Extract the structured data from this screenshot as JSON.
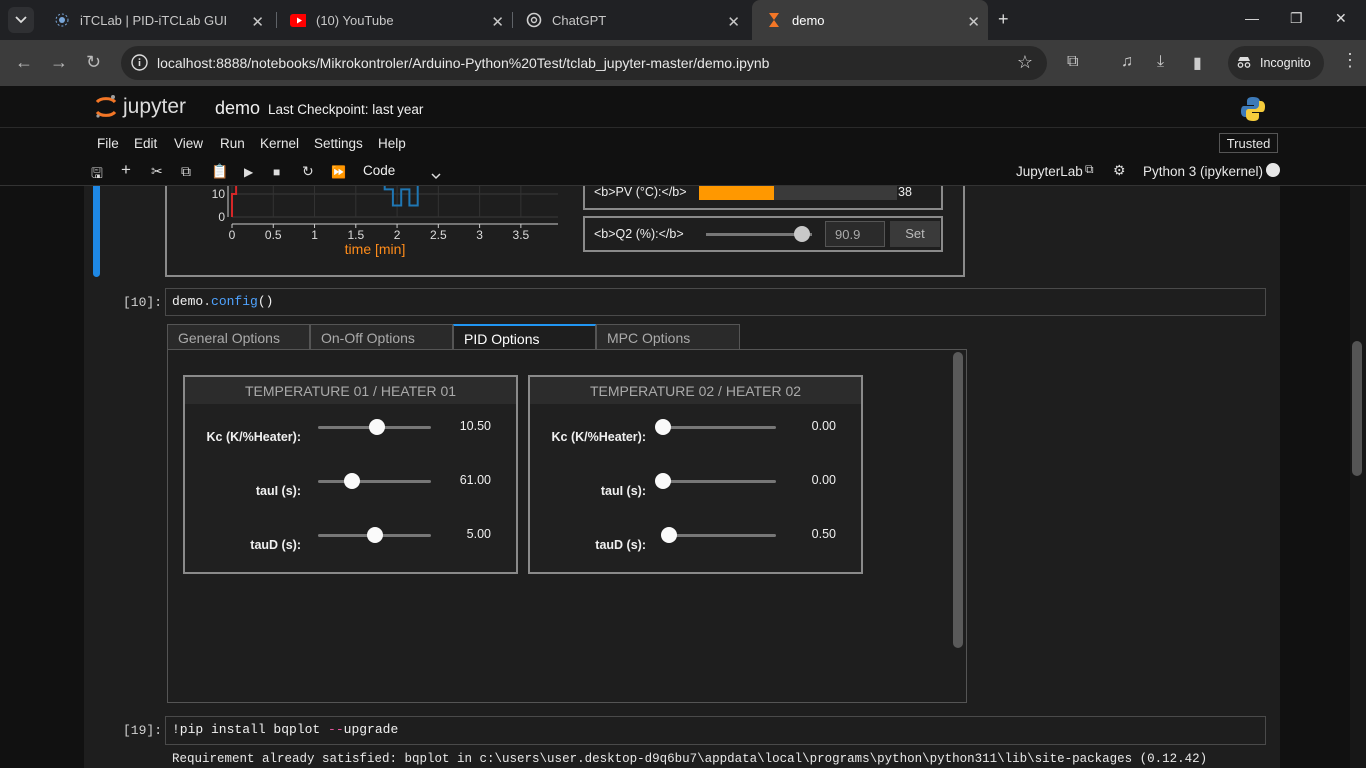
{
  "browser": {
    "tabs": [
      {
        "title": "iTCLab | PID-iTCLab GUI",
        "icon": "itclab-icon"
      },
      {
        "title": "(10) YouTube",
        "icon": "youtube-icon"
      },
      {
        "title": "ChatGPT",
        "icon": "chatgpt-icon"
      },
      {
        "title": "demo",
        "icon": "hourglass-icon"
      }
    ],
    "url": "localhost:8888/notebooks/Mikrokontroler/Arduino-Python%20Test/tclab_jupyter-master/demo.ipynb",
    "incognito_label": "Incognito",
    "colors": {
      "accent": "#f37626",
      "youtube": "#ff0000"
    }
  },
  "jupyter": {
    "logo_text": "jupyter",
    "notebook_name": "demo",
    "checkpoint": "Last Checkpoint: last year",
    "trusted": "Trusted",
    "menus": [
      "File",
      "Edit",
      "View",
      "Run",
      "Kernel",
      "Settings",
      "Help"
    ],
    "cell_type": "Code",
    "jupyterlab_label": "JupyterLab",
    "kernel": "Python 3 (ipykernel)"
  },
  "plot": {
    "chart_data": {
      "type": "line",
      "xlabel": "time [min]",
      "x_ticks": [
        "0",
        "0.5",
        "1",
        "1.5",
        "2",
        "2.5",
        "3",
        "3.5"
      ],
      "y_ticks": [
        "10",
        "0"
      ],
      "series": [
        {
          "color": "#d62728",
          "points": [
            [
              0.0,
              0
            ],
            [
              0.0,
              10
            ],
            [
              0.05,
              10
            ],
            [
              0.05,
              20
            ]
          ]
        },
        {
          "color": "#1f77b4",
          "points": [
            [
              1.85,
              20
            ],
            [
              1.85,
              12
            ],
            [
              1.95,
              12
            ],
            [
              1.95,
              5
            ],
            [
              2.05,
              5
            ],
            [
              2.05,
              12
            ],
            [
              2.15,
              12
            ],
            [
              2.15,
              5
            ],
            [
              2.25,
              5
            ],
            [
              2.25,
              20
            ]
          ]
        }
      ],
      "xlim": [
        0,
        3.95
      ],
      "ylim": [
        0,
        20
      ]
    }
  },
  "controls": {
    "pv_label": "<b>PV (°C):</b>",
    "pv_value": "38",
    "pv_fraction": 0.38,
    "q2_label": "<b>Q2 (%):</b>",
    "q2_input": "90.9",
    "q2_fraction": 0.909,
    "set_label": "Set"
  },
  "cells": [
    {
      "prompt": "[10]:",
      "code_obj": "demo",
      "code_dot": ".",
      "code_fn": "config",
      "code_args": "()"
    },
    {
      "prompt": "[19]:",
      "code_cmd": "!pip install bqplot ",
      "code_flag": "--",
      "code_rest": "upgrade",
      "output": "Requirement already satisfied: bqplot in c:\\users\\user.desktop-d9q6bu7\\appdata\\local\\programs\\python\\python311\\lib\\site-packages (0.12.42)"
    }
  ],
  "config_tabs": [
    "General Options",
    "On-Off Options",
    "PID Options",
    "MPC Options"
  ],
  "pid": [
    {
      "title": "TEMPERATURE 01 / HEATER 01",
      "params": [
        {
          "label": "Kc (K/%Heater):",
          "value": "10.50",
          "fraction": 0.52
        },
        {
          "label": "tauI (s):",
          "value": "61.00",
          "fraction": 0.3
        },
        {
          "label": "tauD (s):",
          "value": "5.00",
          "fraction": 0.5
        }
      ]
    },
    {
      "title": "TEMPERATURE 02 / HEATER 02",
      "params": [
        {
          "label": "Kc (K/%Heater):",
          "value": "0.00",
          "fraction": 0.0
        },
        {
          "label": "tauI (s):",
          "value": "0.00",
          "fraction": 0.0
        },
        {
          "label": "tauD (s):",
          "value": "0.50",
          "fraction": 0.05
        }
      ]
    }
  ]
}
